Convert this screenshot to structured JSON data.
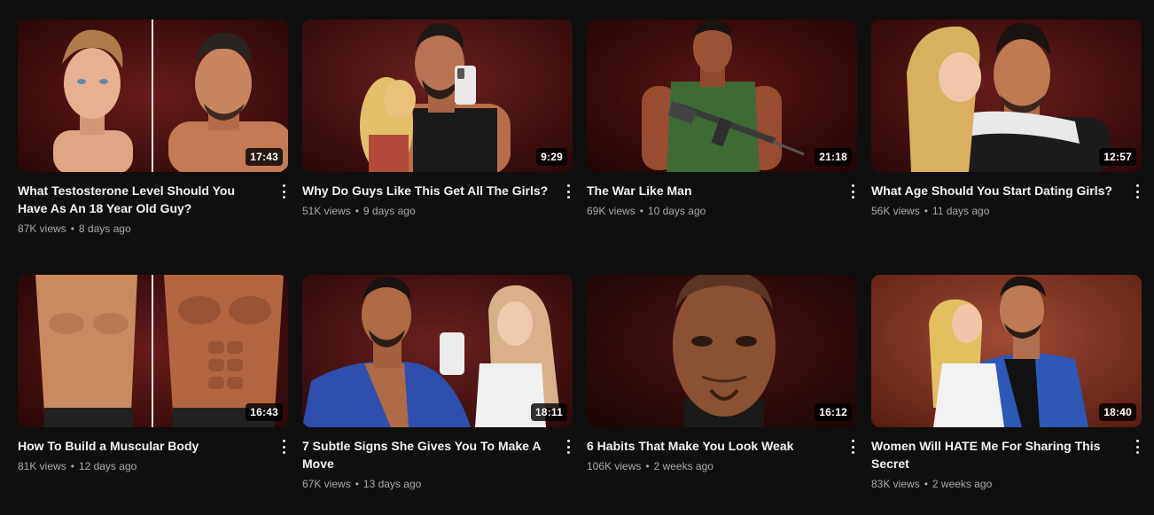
{
  "videos": [
    {
      "title": "What Testosterone Level Should You Have As An 18 Year Old Guy?",
      "views": "87K views",
      "age": "8 days ago",
      "duration": "17:43"
    },
    {
      "title": "Why Do Guys Like This Get All The Girls?",
      "views": "51K views",
      "age": "9 days ago",
      "duration": "9:29"
    },
    {
      "title": "The War Like Man",
      "views": "69K views",
      "age": "10 days ago",
      "duration": "21:18"
    },
    {
      "title": "What Age Should You Start Dating Girls?",
      "views": "56K views",
      "age": "11 days ago",
      "duration": "12:57"
    },
    {
      "title": "How To Build a Muscular Body",
      "views": "81K views",
      "age": "12 days ago",
      "duration": "16:43"
    },
    {
      "title": "7 Subtle Signs She Gives You To Make A Move",
      "views": "67K views",
      "age": "13 days ago",
      "duration": "18:11"
    },
    {
      "title": "6 Habits That Make You Look Weak",
      "views": "106K views",
      "age": "2 weeks ago",
      "duration": "16:12"
    },
    {
      "title": "Women Will HATE Me For Sharing This Secret",
      "views": "83K views",
      "age": "2 weeks ago",
      "duration": "18:40"
    }
  ],
  "separator": "•",
  "more_icon": "more-vert-icon"
}
